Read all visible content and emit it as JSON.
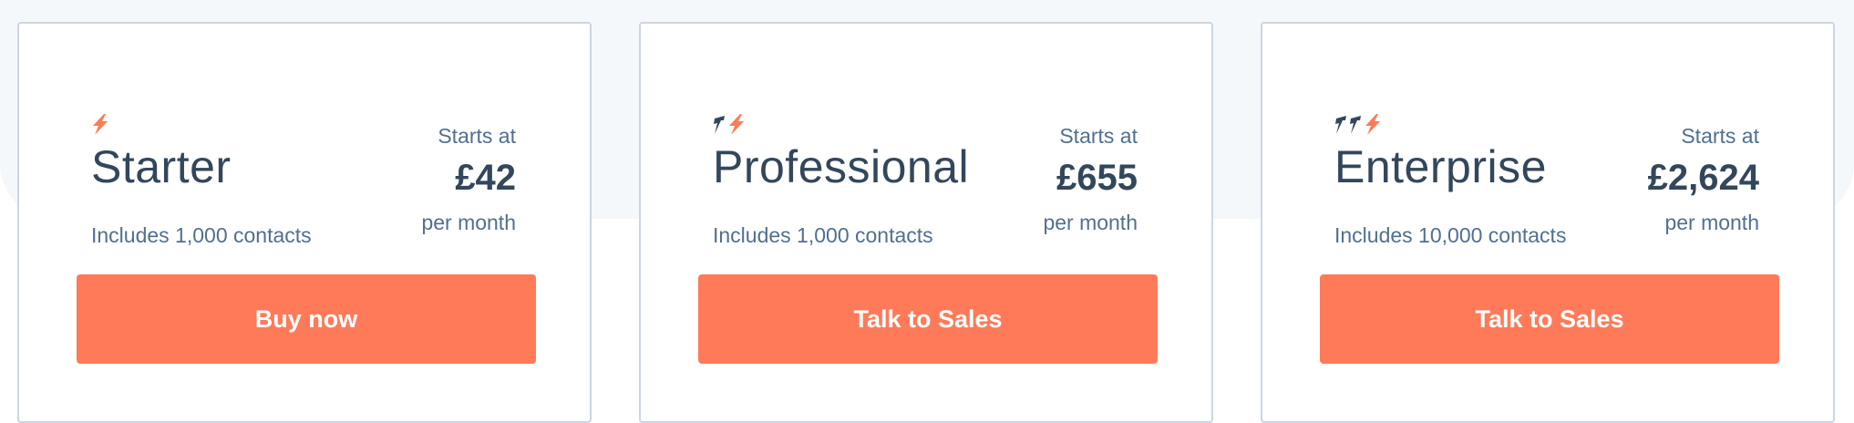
{
  "colors": {
    "accent": "#ff7a59",
    "heading": "#33475b",
    "subtext": "#516f90",
    "card_border": "#cbd6e2",
    "page_band": "#f5f8fa"
  },
  "plans": [
    {
      "name": "Starter",
      "contacts": "Includes 1,000 contacts",
      "starts_at": "Starts at",
      "price": "£42",
      "per_month": "per month",
      "cta_label": "Buy now",
      "icon": "one-bolt-icon"
    },
    {
      "name": "Professional",
      "contacts": "Includes 1,000 contacts",
      "starts_at": "Starts at",
      "price": "£655",
      "per_month": "per month",
      "cta_label": "Talk to Sales",
      "icon": "two-bolts-icon"
    },
    {
      "name": "Enterprise",
      "contacts": "Includes 10,000 contacts",
      "starts_at": "Starts at",
      "price": "£2,624",
      "per_month": "per month",
      "cta_label": "Talk to Sales",
      "icon": "three-bolts-icon"
    }
  ]
}
